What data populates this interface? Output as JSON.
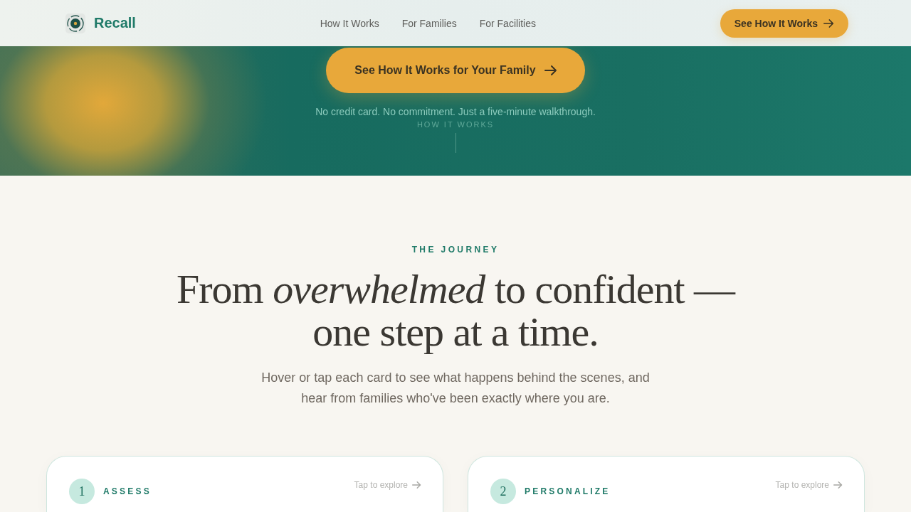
{
  "header": {
    "brand": "Recall",
    "nav": [
      {
        "label": "How It Works"
      },
      {
        "label": "For Families"
      },
      {
        "label": "For Facilities"
      }
    ],
    "cta": "See How It Works"
  },
  "hero": {
    "cta": "See How It Works for Your Family",
    "note": "No credit card. No commitment. Just a five-minute walkthrough.",
    "scroll_label": "HOW IT WORKS"
  },
  "journey": {
    "eyebrow": "THE JOURNEY",
    "heading": "From *overwhelmed* to confident — one step at a time.",
    "intro": "Hover or tap each card to see what happens behind the scenes, and hear from families who've been exactly where you are.",
    "cards": [
      {
        "number": "1",
        "title": "ASSESS",
        "hint": "Tap to explore"
      },
      {
        "number": "2",
        "title": "PERSONALIZE",
        "hint": "Tap to explore"
      }
    ]
  }
}
